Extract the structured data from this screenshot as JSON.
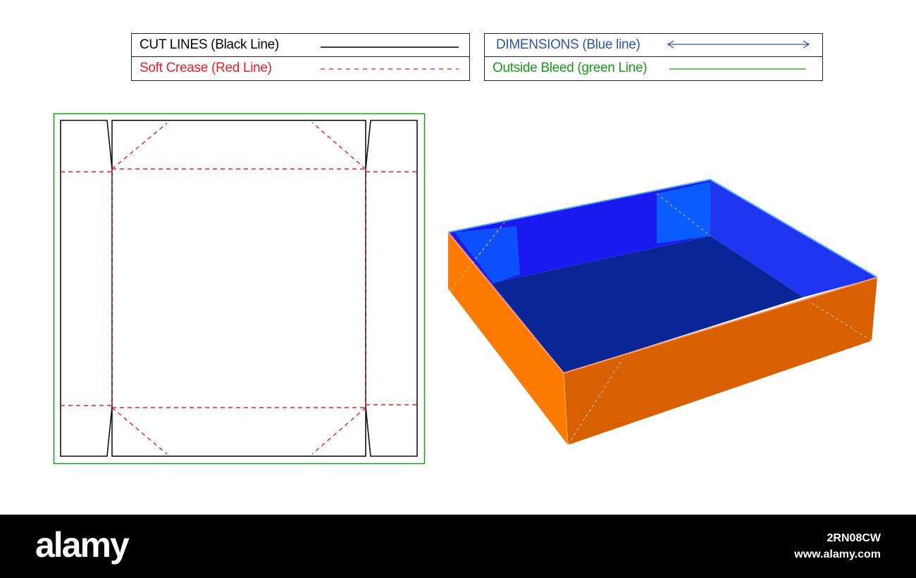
{
  "legend": {
    "cut_lines": "CUT LINES (Black Line)",
    "soft_crease": "Soft Crease (Red Line)",
    "dimensions": "DIMENSIONS (Blue line)",
    "outside_bleed": "Outside Bleed (green Line)"
  },
  "colors": {
    "cut": "#000000",
    "crease": "#e8202a",
    "dimension": "#2d55a8",
    "bleed": "#1a9a1a",
    "box_outer_left": "#ff7a00",
    "box_outer_front": "#d96000",
    "box_floor": "#0a2696",
    "box_inner_back": "#1a1aee",
    "box_inner_right": "#1f35f0"
  },
  "footer": {
    "logo": "alamy",
    "image_id": "2RN08CW",
    "site": "www.alamy.com"
  }
}
